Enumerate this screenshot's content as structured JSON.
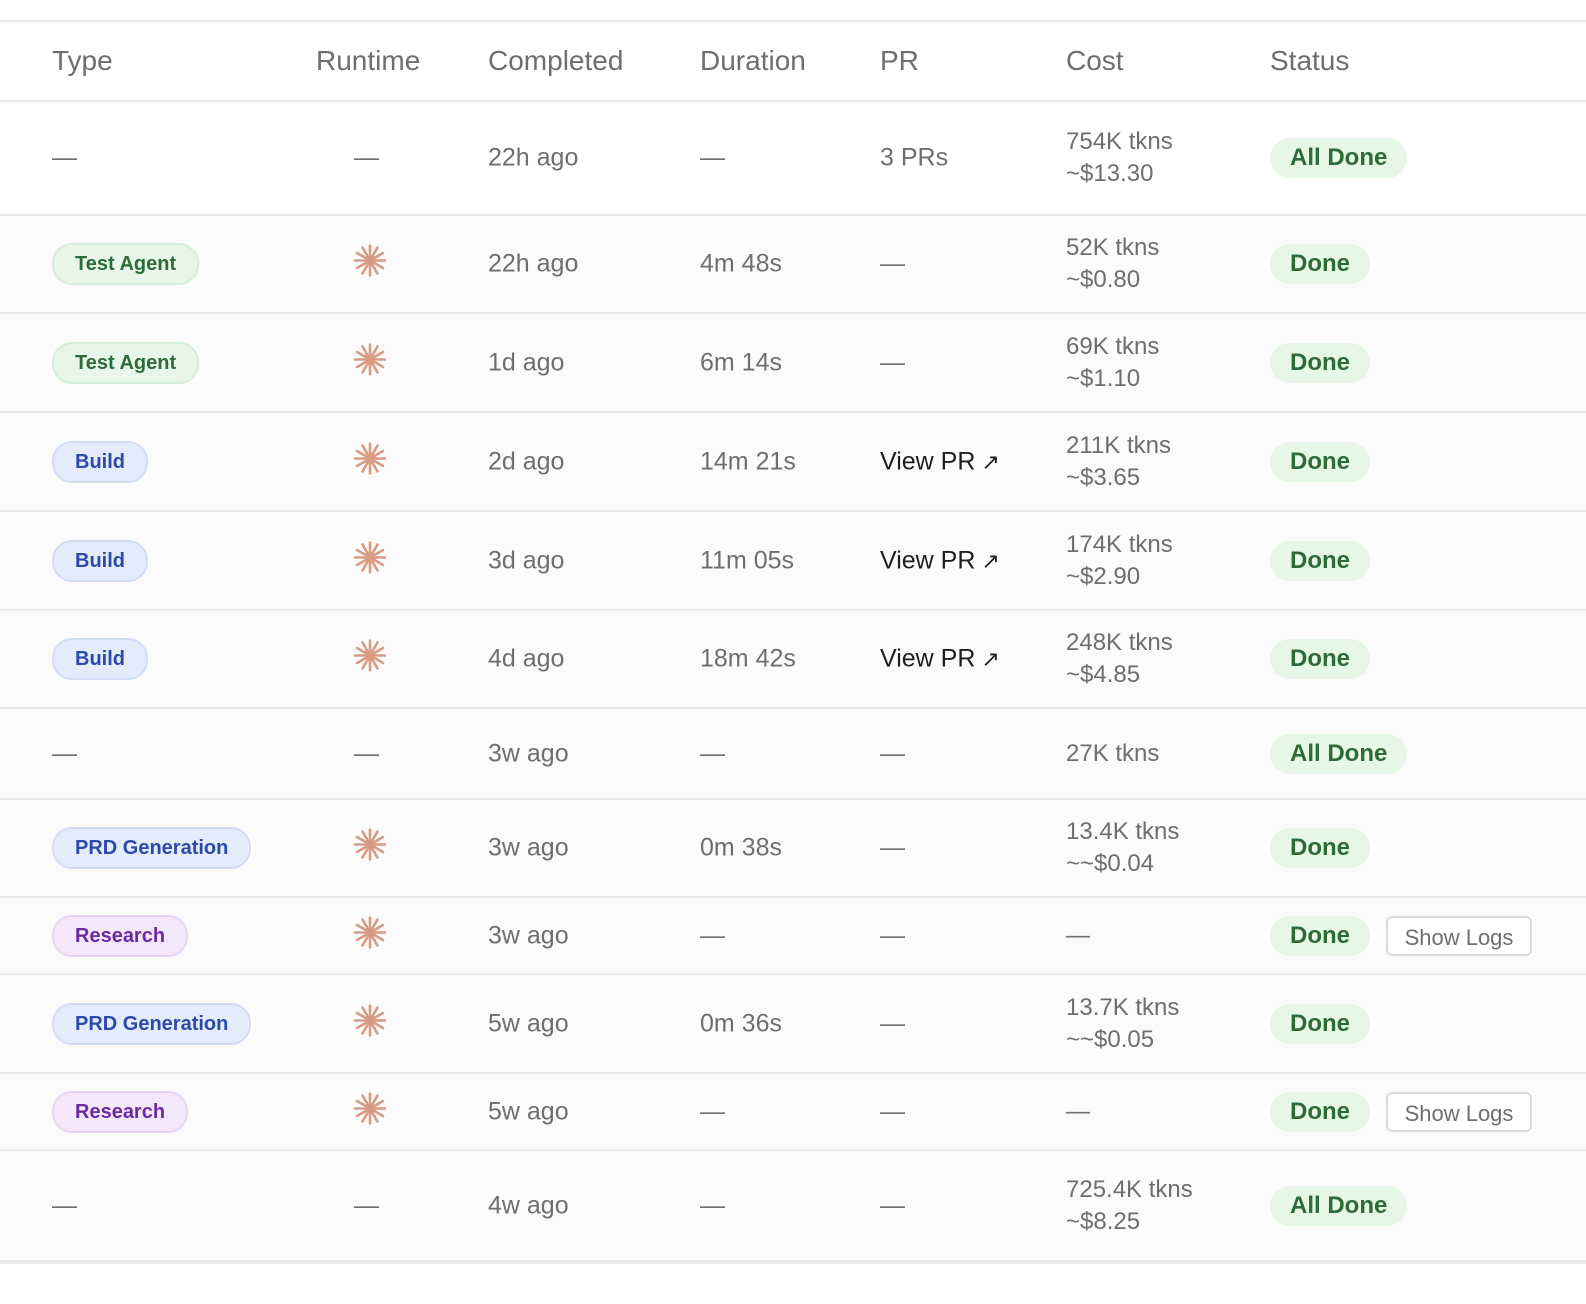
{
  "table": {
    "headers": {
      "type": "Type",
      "runtime": "Runtime",
      "completed": "Completed",
      "duration": "Duration",
      "pr": "PR",
      "cost": "Cost",
      "status": "Status"
    },
    "rows": [
      {
        "type": "—",
        "type_kind": "none",
        "runtime": "—",
        "completed": "22h ago",
        "duration": "—",
        "pr": "3 PRs",
        "pr_kind": "text",
        "cost_tokens": "754K tkns",
        "cost_usd": "~$13.30",
        "status": "All Done"
      },
      {
        "type": "Test Agent",
        "type_kind": "test",
        "runtime": "starburst-icon",
        "completed": "22h ago",
        "duration": "4m 48s",
        "pr": "—",
        "pr_kind": "dash",
        "cost_tokens": "52K tkns",
        "cost_usd": "~$0.80",
        "status": "Done"
      },
      {
        "type": "Test Agent",
        "type_kind": "test",
        "runtime": "starburst-icon",
        "completed": "1d ago",
        "duration": "6m 14s",
        "pr": "—",
        "pr_kind": "dash",
        "cost_tokens": "69K tkns",
        "cost_usd": "~$1.10",
        "status": "Done"
      },
      {
        "type": "Build",
        "type_kind": "build",
        "runtime": "starburst-icon",
        "completed": "2d ago",
        "duration": "14m 21s",
        "pr": "View PR",
        "pr_kind": "link",
        "cost_tokens": "211K tkns",
        "cost_usd": "~$3.65",
        "status": "Done"
      },
      {
        "type": "Build",
        "type_kind": "build",
        "runtime": "starburst-icon",
        "completed": "3d ago",
        "duration": "11m 05s",
        "pr": "View PR",
        "pr_kind": "link",
        "cost_tokens": "174K tkns",
        "cost_usd": "~$2.90",
        "status": "Done"
      },
      {
        "type": "Build",
        "type_kind": "build",
        "runtime": "starburst-icon",
        "completed": "4d ago",
        "duration": "18m 42s",
        "pr": "View PR",
        "pr_kind": "link",
        "cost_tokens": "248K tkns",
        "cost_usd": "~$4.85",
        "status": "Done"
      },
      {
        "type": "—",
        "type_kind": "none",
        "runtime": "—",
        "completed": "3w ago",
        "duration": "—",
        "pr": "—",
        "pr_kind": "dash",
        "cost_tokens": "27K tkns",
        "cost_usd": "",
        "status": "All Done"
      },
      {
        "type": "PRD Generation",
        "type_kind": "prd",
        "runtime": "starburst-icon",
        "completed": "3w ago",
        "duration": "0m 38s",
        "pr": "—",
        "pr_kind": "dash",
        "cost_tokens": "13.4K tkns",
        "cost_usd": "~~$0.04",
        "status": "Done"
      },
      {
        "type": "Research",
        "type_kind": "research",
        "runtime": "starburst-icon",
        "completed": "3w ago",
        "duration": "—",
        "pr": "—",
        "pr_kind": "dash",
        "cost_tokens": "—",
        "cost_usd": "",
        "status": "Done",
        "logs_button": "Show Logs"
      },
      {
        "type": "PRD Generation",
        "type_kind": "prd",
        "runtime": "starburst-icon",
        "completed": "5w ago",
        "duration": "0m 36s",
        "pr": "—",
        "pr_kind": "dash",
        "cost_tokens": "13.7K tkns",
        "cost_usd": "~~$0.05",
        "status": "Done"
      },
      {
        "type": "Research",
        "type_kind": "research",
        "runtime": "starburst-icon",
        "completed": "5w ago",
        "duration": "—",
        "pr": "—",
        "pr_kind": "dash",
        "cost_tokens": "—",
        "cost_usd": "",
        "status": "Done",
        "logs_button": "Show Logs"
      },
      {
        "type": "—",
        "type_kind": "none",
        "runtime": "—",
        "completed": "4w ago",
        "duration": "—",
        "pr": "—",
        "pr_kind": "dash",
        "cost_tokens": "725.4K tkns",
        "cost_usd": "~$8.25",
        "status": "All Done"
      }
    ],
    "pr_link_arrow_icon": "arrow-up-right-icon",
    "colors": {
      "runtime_icon": "#d99a82",
      "status_text": "#2f6b3a",
      "status_bg": "#e6f7e6"
    }
  }
}
